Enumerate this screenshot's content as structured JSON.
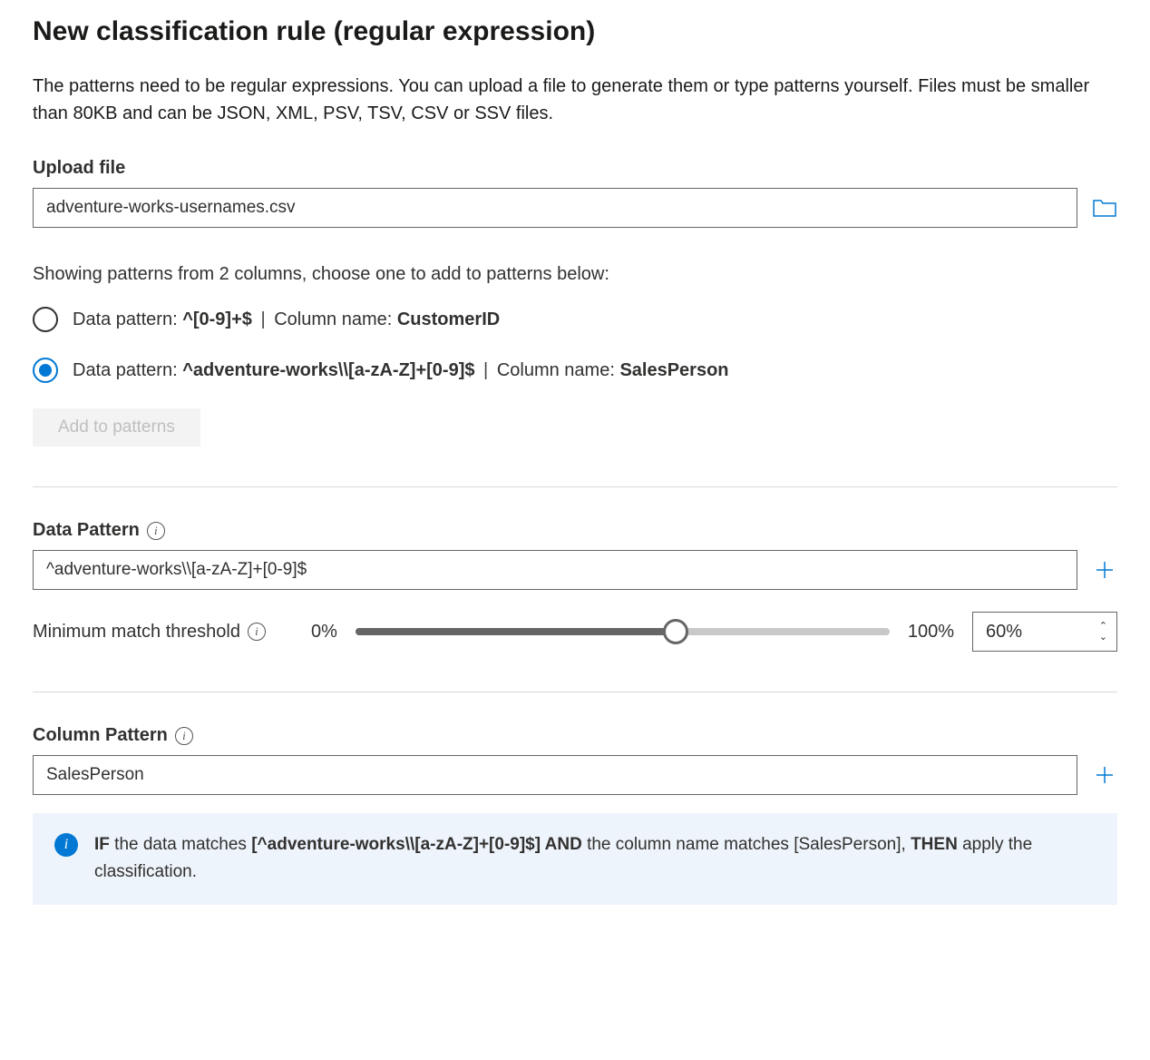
{
  "title": "New classification rule (regular expression)",
  "description": "The patterns need to be regular expressions. You can upload a file to generate them or type patterns yourself. Files must be smaller than 80KB and can be JSON, XML, PSV, TSV, CSV or SSV files.",
  "upload": {
    "label": "Upload file",
    "filename": "adventure-works-usernames.csv"
  },
  "patternsHeading": "Showing patterns from 2 columns, choose one to add to patterns below:",
  "options": [
    {
      "dataLabel": "Data pattern: ",
      "pattern": "^[0-9]+$",
      "colLabel": "Column name: ",
      "colName": "CustomerID",
      "selected": false
    },
    {
      "dataLabel": "Data pattern: ",
      "pattern": "^adventure-works\\\\[a-zA-Z]+[0-9]$",
      "colLabel": "Column name: ",
      "colName": "SalesPerson",
      "selected": true
    }
  ],
  "addButton": "Add to patterns",
  "dataPattern": {
    "label": "Data Pattern",
    "value": "^adventure-works\\\\[a-zA-Z]+[0-9]$"
  },
  "threshold": {
    "label": "Minimum match threshold",
    "minLabel": "0%",
    "maxLabel": "100%",
    "value": "60%"
  },
  "columnPattern": {
    "label": "Column Pattern",
    "value": "SalesPerson"
  },
  "infoBox": {
    "ifText": "IF",
    "dataMatchesText": " the data matches ",
    "dataPattern": "[^adventure-works\\\\[a-zA-Z]+[0-9]$]",
    "andText": " AND",
    "colMatchesText": " the column name matches ",
    "colPattern": "[SalesPerson]",
    "sep": ", ",
    "thenText": "THEN",
    "applyText": " apply the classification."
  }
}
